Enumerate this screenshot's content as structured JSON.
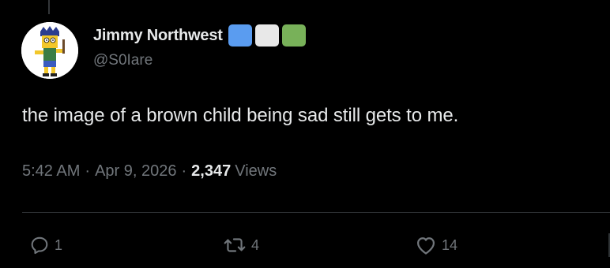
{
  "author": {
    "display_name": "Jimmy Northwest",
    "handle": "@S0Iare",
    "name_emojis": [
      {
        "name": "blue-square",
        "color": "#5a9cf0"
      },
      {
        "name": "white-square",
        "color": "#e8e8e8"
      },
      {
        "name": "green-square",
        "color": "#78b159"
      }
    ]
  },
  "tweet": {
    "text": "the image of a brown child being sad still gets to me."
  },
  "meta": {
    "time": "5:42 AM",
    "separator": "·",
    "date": "Apr 9, 2026",
    "views_count": "2,347",
    "views_label": "Views"
  },
  "actions": {
    "reply": {
      "icon": "reply-icon",
      "count": "1"
    },
    "repost": {
      "icon": "repost-icon",
      "count": "4"
    },
    "like": {
      "icon": "heart-icon",
      "count": "14"
    }
  },
  "colors": {
    "background": "#000000",
    "primary_text": "#e7e9ea",
    "secondary_text": "#71767b",
    "divider": "#2f3336"
  }
}
